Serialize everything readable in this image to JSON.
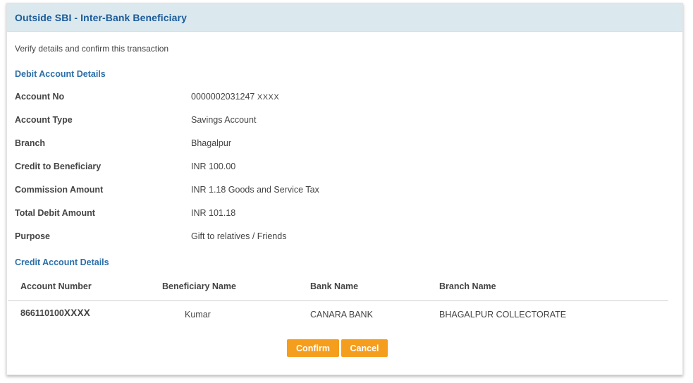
{
  "header": {
    "title": "Outside SBI - Inter-Bank Beneficiary"
  },
  "intro_text": "Verify details and confirm this transaction",
  "debit_section": {
    "title": "Debit Account Details",
    "rows": [
      {
        "label": "Account No",
        "value": "0000002031247",
        "mask": "XXXX"
      },
      {
        "label": "Account Type",
        "value": "Savings Account"
      },
      {
        "label": "Branch",
        "value": "Bhagalpur"
      },
      {
        "label": "Credit to Beneficiary",
        "value": "INR 100.00"
      },
      {
        "label": "Commission Amount",
        "value": "INR 1.18 Goods and Service Tax"
      },
      {
        "label": "Total Debit Amount",
        "value": "INR 101.18"
      },
      {
        "label": "Purpose",
        "value": "Gift to relatives / Friends"
      }
    ]
  },
  "credit_section": {
    "title": "Credit Account Details",
    "columns": [
      "Account Number",
      "Beneficiary Name",
      "Bank Name",
      "Branch Name"
    ],
    "rows": [
      {
        "account_number": "866110100",
        "account_mask": "XXXX",
        "beneficiary_name": "Kumar",
        "bank_name": "CANARA BANK",
        "branch_name": "BHAGALPUR COLLECTORATE"
      }
    ]
  },
  "actions": {
    "confirm_label": "Confirm",
    "cancel_label": "Cancel"
  },
  "colors": {
    "header_bg": "#dbe9ee",
    "title": "#1a5a9a",
    "section_title": "#2b6ea8",
    "button": "#f59d1c"
  }
}
